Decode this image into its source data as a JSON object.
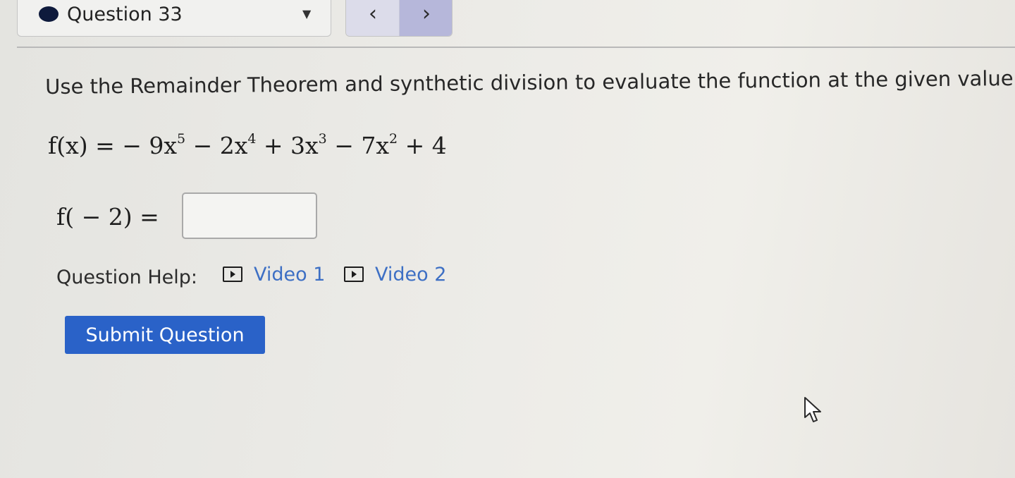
{
  "navigation": {
    "question_label": "Question 33",
    "dropdown_icon": "caret-down-icon",
    "prev_icon": "chevron-left-icon",
    "next_icon": "chevron-right-icon",
    "prev_glyph": "‹",
    "next_glyph": "›",
    "caret_glyph": "▼",
    "status_color": "#0e1a3c",
    "next_bg_color": "#b6b7da"
  },
  "question": {
    "prompt": "Use the Remainder Theorem and synthetic division to evaluate the function at the given value.",
    "function": {
      "lhs": "f(x) =",
      "terms": [
        {
          "text": "− 9x",
          "exp": "5"
        },
        {
          "text": " − 2x",
          "exp": "4"
        },
        {
          "text": " + 3x",
          "exp": "3"
        },
        {
          "text": " − 7x",
          "exp": "2"
        },
        {
          "text": " + 4",
          "exp": ""
        }
      ]
    },
    "evaluation_label": "f( − 2) =",
    "answer": {
      "value": "",
      "placeholder": ""
    }
  },
  "help": {
    "label": "Question Help:",
    "videos": [
      {
        "label": "Video 1",
        "icon": "play-video-icon"
      },
      {
        "label": "Video 2",
        "icon": "play-video-icon"
      }
    ],
    "link_color": "#3d6fc4"
  },
  "submit": {
    "label": "Submit Question",
    "color": "#2a62c8"
  },
  "cursor": {
    "icon": "mouse-pointer-icon"
  }
}
